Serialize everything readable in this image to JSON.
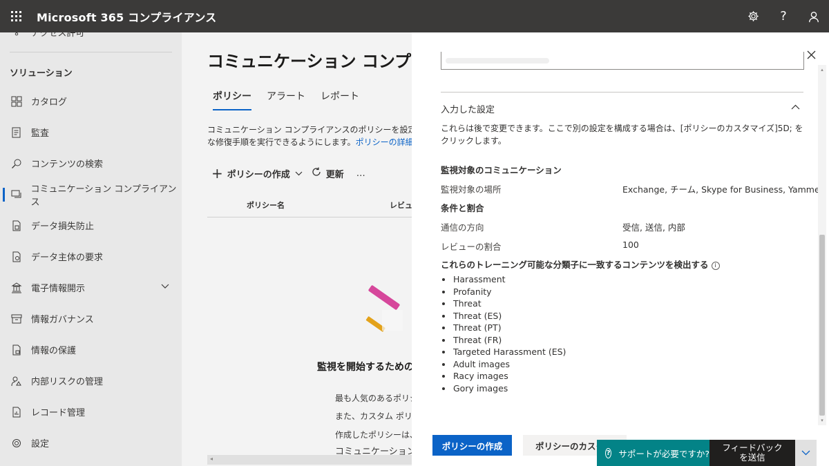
{
  "topbar": {
    "app_title": "Microsoft 365 コンプライアンス",
    "icons": [
      "waffle-icon",
      "settings-icon",
      "help-icon",
      "account-icon"
    ]
  },
  "leftnav": {
    "partial_item": "アクセス許可",
    "section_label": "ソリューション",
    "items": [
      {
        "label": "カタログ",
        "icon": "catalog-icon"
      },
      {
        "label": "監査",
        "icon": "audit-icon"
      },
      {
        "label": "コンテンツの検索",
        "icon": "search-icon"
      },
      {
        "label": "コミュニケーション コンプライアンス",
        "icon": "communication-icon",
        "active": true
      },
      {
        "label": "データ損失防止",
        "icon": "dlp-icon"
      },
      {
        "label": "データ主体の要求",
        "icon": "dsr-icon"
      },
      {
        "label": "電子情報開示",
        "icon": "ediscovery-icon",
        "expandable": true
      },
      {
        "label": "情報ガバナンス",
        "icon": "governance-icon"
      },
      {
        "label": "情報の保護",
        "icon": "protection-icon"
      },
      {
        "label": "内部リスクの管理",
        "icon": "insider-risk-icon"
      },
      {
        "label": "レコード管理",
        "icon": "records-icon"
      }
    ],
    "settings_partial": "設定"
  },
  "main": {
    "page_title": "コミュニケーション コンプライアンス",
    "tabs": [
      "ポリシー",
      "アラート",
      "レポート"
    ],
    "description_line1": "コミュニケーション コンプライアンスのポリシーを設定して、内容",
    "description_line2": "な修復手順を実行できるようにします。",
    "description_link": "ポリシーの詳細",
    "toolbar": {
      "create": "ポリシーの作成",
      "refresh": "更新",
      "more": "…"
    },
    "columns": [
      "ポリシー名",
      "レビュー"
    ],
    "empty_title": "監視を開始するための通",
    "empty_line1": "最も人気のあるポリシ",
    "empty_line2": "また、カスタム ポリシー",
    "empty_line3": "作成したポリシーは、こ",
    "empty_link": "コミュニケーション コン"
  },
  "panel": {
    "section_title": "入力した設定",
    "section_desc": "これらは後で変更できます。ここで別の設定を構成する場合は、[ポリシーのカスタマイズ]5D; をクリックします。",
    "monitored_heading": "監視対象のコミュニケーション",
    "location_label": "監視対象の場所",
    "location_value": "Exchange, チーム, Skype for Business, Yammer",
    "conditions_heading": "条件と割合",
    "direction_label": "通信の方向",
    "direction_value": "受信, 送信, 内部",
    "review_label": "レビューの割合",
    "review_value": "100",
    "classifiers_heading": "これらのトレーニング可能な分類子に一致するコンテンツを検出する",
    "classifiers": [
      "Harassment",
      "Profanity",
      "Threat",
      "Threat (ES)",
      "Threat (PT)",
      "Threat (FR)",
      "Targeted Harassment (ES)",
      "Adult images",
      "Racy images",
      "Gory images"
    ],
    "primary_button": "ポリシーの作成",
    "secondary_button": "ポリシーのカスタマイズ"
  },
  "helpbar": {
    "help_label": "サポートが必要ですか?",
    "feedback_label": "フィードバックを送信"
  },
  "colors": {
    "accent": "#0b63c7",
    "topbar": "#3b3a39",
    "help": "#038387",
    "feedback": "#201f1e"
  }
}
